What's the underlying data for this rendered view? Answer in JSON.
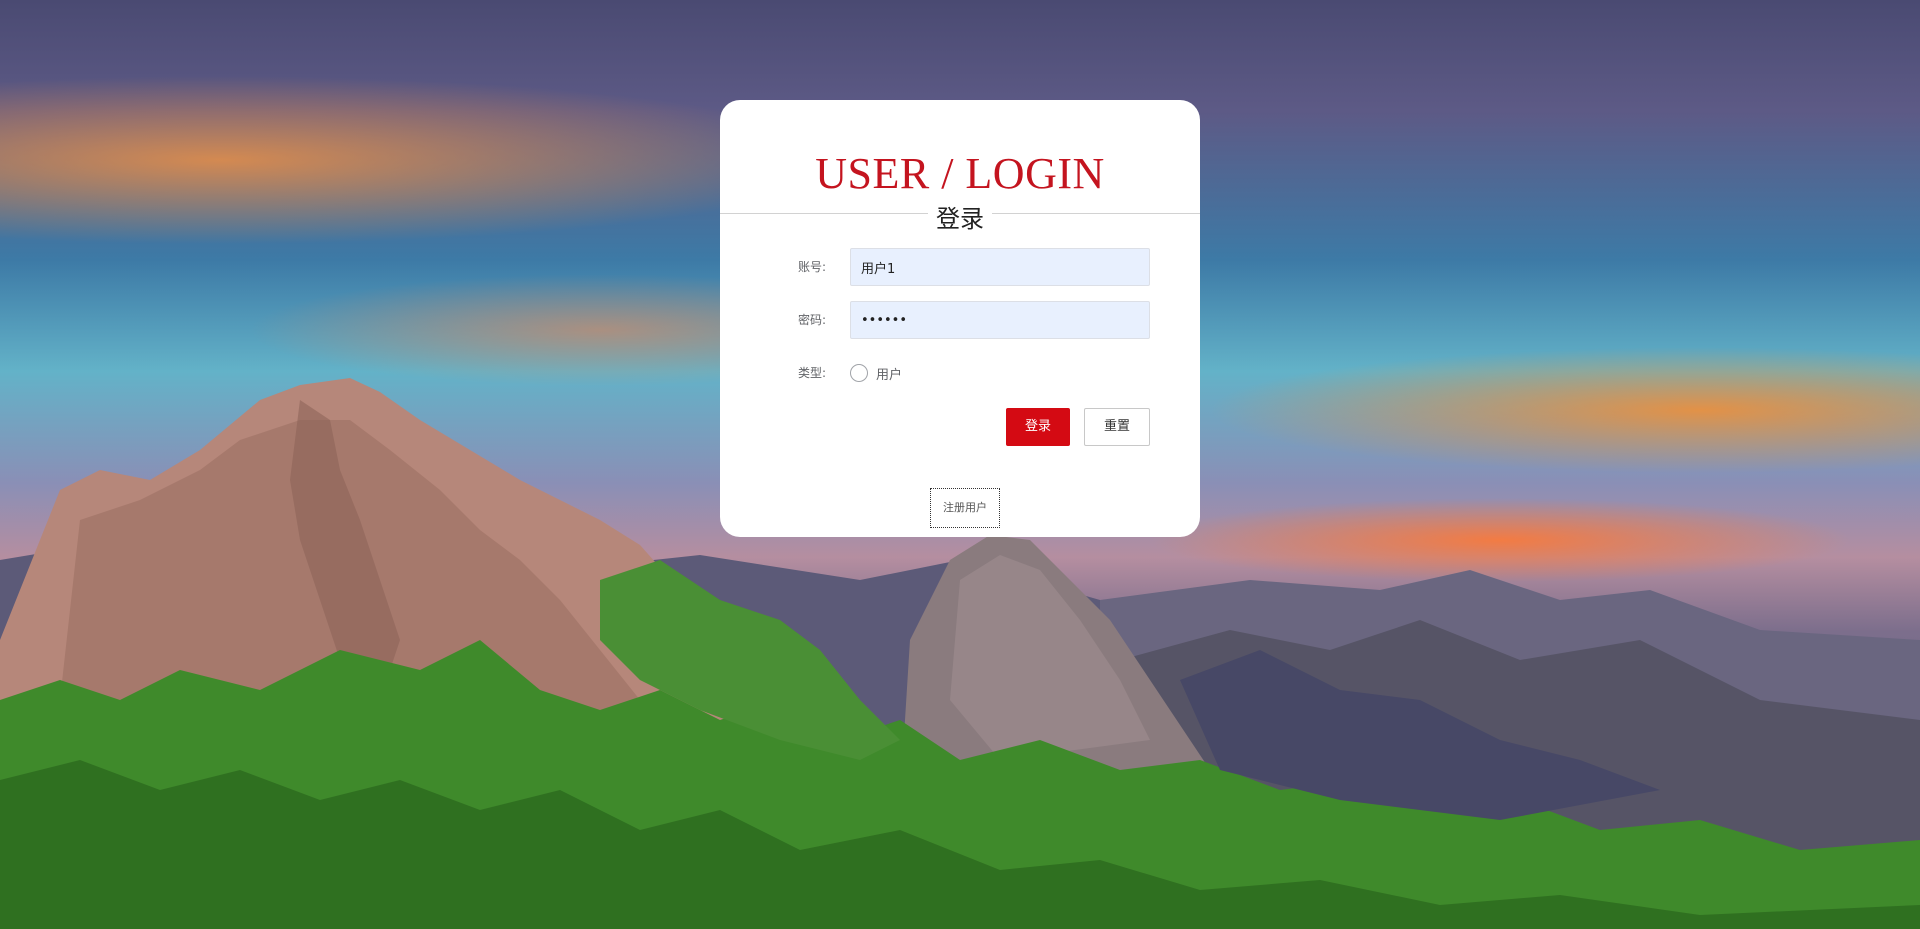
{
  "background": {
    "description_colors": {
      "sky_top": "#4a4a72",
      "sky_mid": "#63b2c8",
      "sunset": "#ff9640",
      "foliage": "#3f8a2b",
      "rock": "#b98a7e"
    }
  },
  "login_card": {
    "title": "USER / LOGIN",
    "subtitle": "登录",
    "title_color": "#c4141f",
    "account": {
      "label": "账号:",
      "value": "用户1"
    },
    "password": {
      "label": "密码:",
      "value": "••••••"
    },
    "type": {
      "label": "类型:",
      "options": [
        "用户"
      ],
      "selected": null
    },
    "buttons": {
      "login": "登录",
      "reset": "重置"
    },
    "register_link": "注册用户",
    "accent_color": "#d40a13"
  }
}
